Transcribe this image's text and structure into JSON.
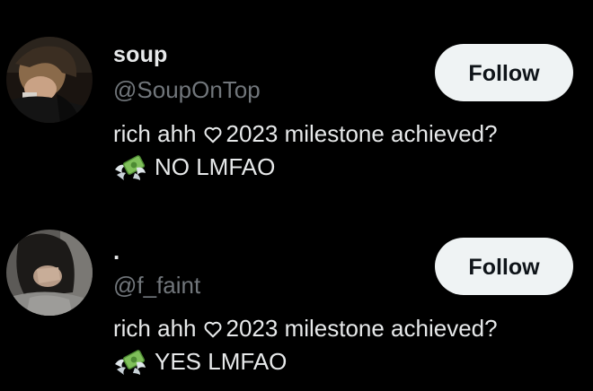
{
  "users": [
    {
      "display_name": "soup",
      "handle": "@SoupOnTop",
      "follow_label": "Follow",
      "bio_line1_start": "rich ahh",
      "bio_line1_end": "2023 milestone achieved?",
      "bio_line2": "NO LMFAO",
      "avatar_icon": "profile-photo",
      "bio_icons": [
        "white-heart-icon",
        "money-with-wings-icon"
      ]
    },
    {
      "display_name": ".",
      "handle": "@f_faint",
      "follow_label": "Follow",
      "bio_line1_start": "rich ahh",
      "bio_line1_end": "2023 milestone achieved?",
      "bio_line2": "YES LMFAO",
      "avatar_icon": "profile-photo",
      "bio_icons": [
        "white-heart-icon",
        "money-with-wings-icon"
      ]
    }
  ],
  "colors": {
    "background": "#000000",
    "primary_text": "#e7e9ea",
    "secondary_text": "#71767b",
    "follow_button_bg": "#eff3f4",
    "follow_button_text": "#0f1419"
  }
}
